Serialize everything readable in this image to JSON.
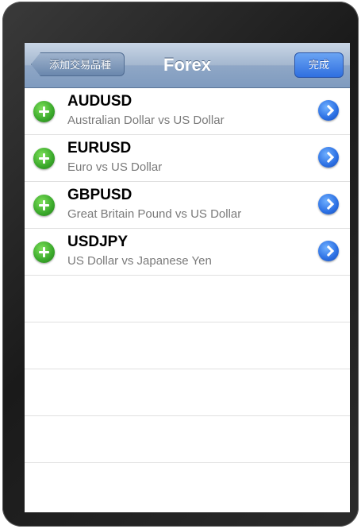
{
  "nav": {
    "back_label": "添加交易品種",
    "title": "Forex",
    "done_label": "完成"
  },
  "instruments": [
    {
      "symbol": "AUDUSD",
      "description": "Australian Dollar vs US Dollar"
    },
    {
      "symbol": "EURUSD",
      "description": "Euro vs US Dollar"
    },
    {
      "symbol": "GBPUSD",
      "description": "Great Britain Pound vs US Dollar"
    },
    {
      "symbol": "USDJPY",
      "description": "US Dollar vs Japanese Yen"
    }
  ],
  "icons": {
    "add": "plus-circle-icon",
    "detail": "chevron-right-circle-icon"
  },
  "colors": {
    "add": "#39a82a",
    "detail": "#2b6fe3",
    "nav_bar": "#8fa7c6"
  }
}
